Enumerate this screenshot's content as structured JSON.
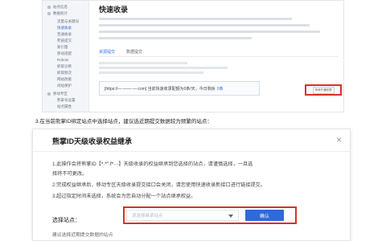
{
  "top_panel": {
    "sidebar": {
      "items": [
        {
          "label": "站点信息",
          "sub": false
        },
        {
          "label": "数据统计",
          "sub": false
        },
        {
          "label": "流量与关键词",
          "sub": true
        },
        {
          "label": "快速收录",
          "sub": true,
          "active": true
        },
        {
          "label": "普通收录",
          "sub": true
        },
        {
          "label": "死链提交",
          "sub": true
        },
        {
          "label": "索引量",
          "sub": true
        },
        {
          "label": "移动适配",
          "sub": true
        },
        {
          "label": "Robots",
          "sub": true
        },
        {
          "label": "抓取诊断",
          "sub": true
        },
        {
          "label": "抓取频次",
          "sub": true
        },
        {
          "label": "网站改版",
          "sub": true
        },
        {
          "label": "闭站保护",
          "sub": true
        },
        {
          "label": "移动专区",
          "sub": false
        },
        {
          "label": "熊掌号设置",
          "sub": true
        },
        {
          "label": "站点属性",
          "sub": true
        }
      ]
    },
    "page_title": "快速收录",
    "tabs": [
      "资源提交",
      "数据提交"
    ],
    "info_box_text": "[https://—·——·—·com] 当前快速收录配额为0条/天，今日剩余",
    "info_box_count": "0条",
    "apply_button": "申请开通权限"
  },
  "caption": "3.在当前熊掌ID绑定站点中选择站点，建议选近期提交数据较为频繁的站点：",
  "dialog": {
    "title": "熊掌ID天级收录权益继承",
    "close": "×",
    "line1_prefix": "1.此操作会将熊掌ID【",
    "line1_name": "*·*\"·f*···",
    "line1_suffix": "】天级收录的权益继承到您选择的站点，请谨慎选择，一旦选",
    "line1b": "择将不可更改。",
    "line2": "2.完成权益继承后，移动专区天级收录提交接口会关闭，请您使用快速收录新接口进行链接提交。",
    "line3": "3.超过指定时间未选择，系统会为您自动分配一个站点继承权益。",
    "select_label": "选择站点：",
    "select_placeholder": "请选择继承站点",
    "confirm": "确认",
    "footer": "建议选择近期提交数据的站点"
  }
}
